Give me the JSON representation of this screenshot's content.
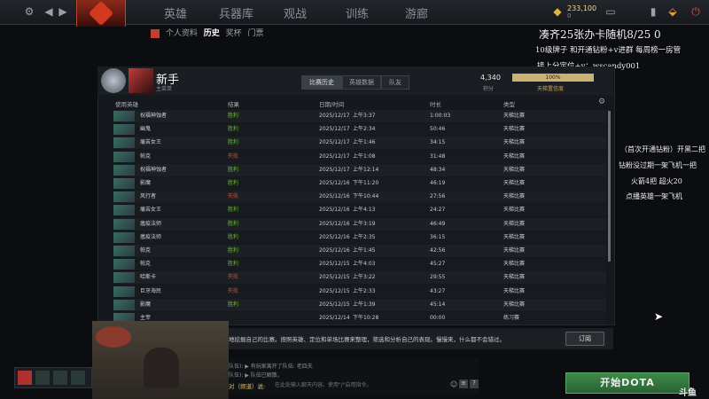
{
  "topnav": {
    "items": [
      "英雄",
      "兵器库",
      "观战",
      "训练",
      "游廊"
    ],
    "currency": "233,100",
    "currency_sub": "0"
  },
  "subnav": [
    "个人资料",
    "历史",
    "奖杯",
    "门票"
  ],
  "overlay": {
    "line1": "凑齐25张办卡随机8/25 0",
    "line2": "10级牌子 和开通钻粉+v进群 每周榜一房管",
    "line3": "接上分定位+v：wscandy001",
    "side1": "（首次开通钻粉）开黑二把",
    "side2": "钻粉没过期一架飞机一把",
    "side3": "火箭4把 超火20",
    "side4": "点播英雄一架飞机"
  },
  "profile": {
    "rank_name": "新手",
    "rank_sub": "主菜单",
    "tabs": [
      "比赛历史",
      "英雄数据",
      "队友"
    ],
    "mmr": "4,340",
    "mmr_label": "积分",
    "confidence": "100%",
    "confidence_label": "天梯置信度",
    "confidence_value": 1.0
  },
  "table": {
    "headers": [
      "使用英雄",
      "结果",
      "日期/时间",
      "时长",
      "类型"
    ],
    "rows": [
      {
        "hero": "祝福神蚀者",
        "result": "胜利",
        "date": "2025/12/17",
        "time": "上午3:37",
        "duration": "1:00:03",
        "type": "天梯比赛",
        "win": true
      },
      {
        "hero": "幽鬼",
        "result": "胜利",
        "date": "2025/12/17",
        "time": "上午2:34",
        "duration": "50:46",
        "type": "天梯比赛",
        "win": true
      },
      {
        "hero": "痛苦女王",
        "result": "胜利",
        "date": "2025/12/17",
        "time": "上午1:46",
        "duration": "34:15",
        "type": "天梯比赛",
        "win": true
      },
      {
        "hero": "帕克",
        "result": "失败",
        "date": "2025/12/17",
        "time": "上午1:08",
        "duration": "31:48",
        "type": "天梯比赛",
        "win": false
      },
      {
        "hero": "祝福神蚀者",
        "result": "胜利",
        "date": "2025/12/17",
        "time": "上午12:14",
        "duration": "48:34",
        "type": "天梯比赛",
        "win": true
      },
      {
        "hero": "影魔",
        "result": "胜利",
        "date": "2025/12/16",
        "time": "下午11:20",
        "duration": "46:19",
        "type": "天梯比赛",
        "win": true
      },
      {
        "hero": "风行者",
        "result": "失败",
        "date": "2025/12/16",
        "time": "下午10:44",
        "duration": "27:56",
        "type": "天梯比赛",
        "win": false
      },
      {
        "hero": "痛苦女王",
        "result": "胜利",
        "date": "2025/12/16",
        "time": "上午4:13",
        "duration": "24:27",
        "type": "天梯比赛",
        "win": true
      },
      {
        "hero": "瘟疫法师",
        "result": "胜利",
        "date": "2025/12/16",
        "time": "上午3:19",
        "duration": "46:49",
        "type": "天梯比赛",
        "win": true
      },
      {
        "hero": "瘟疫法师",
        "result": "胜利",
        "date": "2025/12/16",
        "time": "上午2:35",
        "duration": "36:15",
        "type": "天梯比赛",
        "win": true
      },
      {
        "hero": "帕克",
        "result": "胜利",
        "date": "2025/12/16",
        "time": "上午1:45",
        "duration": "42:56",
        "type": "天梯比赛",
        "win": true
      },
      {
        "hero": "帕克",
        "result": "胜利",
        "date": "2025/12/15",
        "time": "上午4:03",
        "duration": "45:27",
        "type": "天梯比赛",
        "win": true
      },
      {
        "hero": "哈斯卡",
        "result": "失败",
        "date": "2025/12/15",
        "time": "上午3:22",
        "duration": "29:55",
        "type": "天梯比赛",
        "win": false
      },
      {
        "hero": "巨牙海民",
        "result": "失败",
        "date": "2025/12/15",
        "time": "上午2:33",
        "duration": "43:27",
        "type": "天梯比赛",
        "win": false
      },
      {
        "hero": "影魔",
        "result": "胜利",
        "date": "2025/12/15",
        "time": "上午1:39",
        "duration": "45:14",
        "type": "天梯比赛",
        "win": true
      },
      {
        "hero": "主宰",
        "result": "",
        "date": "2025/12/14",
        "time": "下午10:28",
        "duration": "00:00",
        "type": "练习赛",
        "win": true
      }
    ]
  },
  "banner": {
    "text": "地挖掘自己的比赛。按照英雄、定位和单场比赛来整理，筛选和分析自己的表现。慢慢来，什么都不会错过。",
    "subscribe": "订阅"
  },
  "chat": {
    "line1": "队伍): ▶ 有玩家离开了队伍: 老四夫",
    "line2": "队伍): ▶ 队伍已解散。",
    "input_label": "对（频道）说:",
    "placeholder": "在此处输入聊天内容。使用\"/\"启用指令。"
  },
  "play_button": "开始DOTA",
  "watermark": "斗鱼"
}
